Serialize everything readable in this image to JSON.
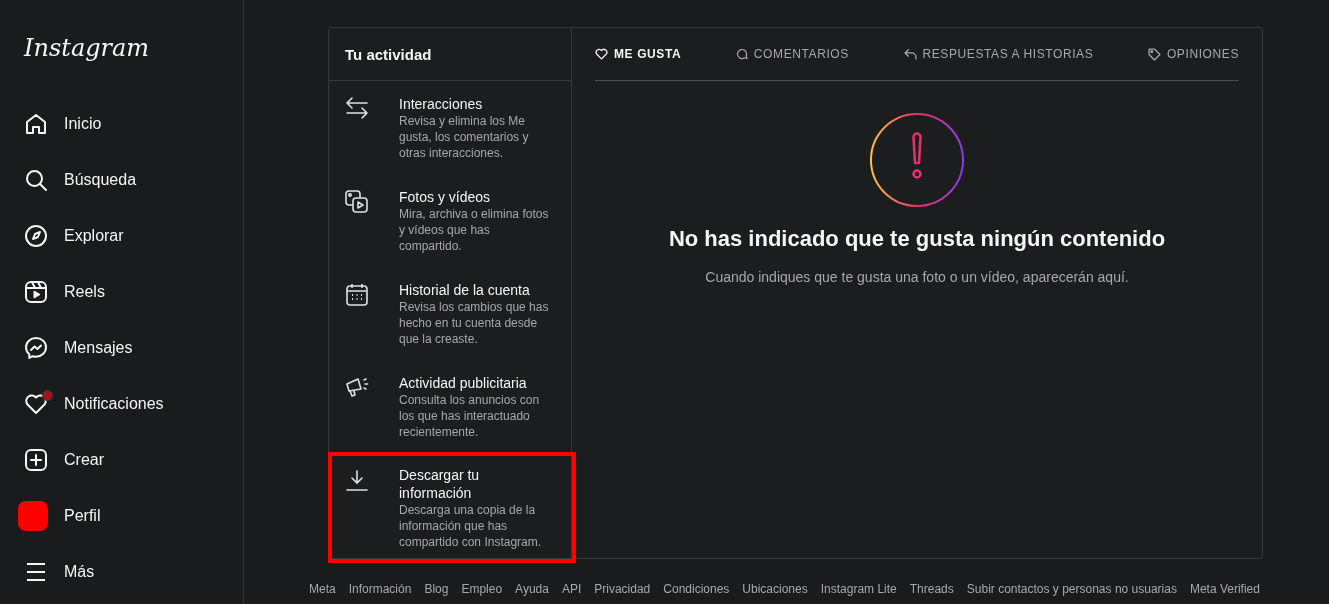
{
  "sidebar": {
    "logo": "Instagram",
    "items": [
      {
        "label": "Inicio",
        "kind": "home",
        "badge": false
      },
      {
        "label": "Búsqueda",
        "kind": "search",
        "badge": false
      },
      {
        "label": "Explorar",
        "kind": "compass",
        "badge": false
      },
      {
        "label": "Reels",
        "kind": "reels",
        "badge": false
      },
      {
        "label": "Mensajes",
        "kind": "messenger",
        "badge": false
      },
      {
        "label": "Notificaciones",
        "kind": "heart",
        "badge": true
      },
      {
        "label": "Crear",
        "kind": "plus",
        "badge": false
      },
      {
        "label": "Perfil",
        "kind": "avatar",
        "badge": false
      },
      {
        "label": "Más",
        "kind": "menu",
        "badge": false
      }
    ]
  },
  "activity": {
    "title": "Tu actividad",
    "items": [
      {
        "kind": "arrows",
        "title": "Interacciones",
        "description": "Revisa y elimina los Me gusta, los comentarios y otras interacciones.",
        "highlighted": false
      },
      {
        "kind": "media",
        "title": "Fotos y vídeos",
        "description": "Mira, archiva o elimina fotos y vídeos que has compartido.",
        "highlighted": false
      },
      {
        "kind": "calendar",
        "title": "Historial de la cuenta",
        "description": "Revisa los cambios que has hecho en tu cuenta desde que la creaste.",
        "highlighted": false
      },
      {
        "kind": "megaphone",
        "title": "Actividad publicitaria",
        "description": "Consulta los anuncios con los que has interactuado recientemente.",
        "highlighted": false
      },
      {
        "kind": "download",
        "title": "Descargar tu información",
        "description": "Descarga una copia de la información que has compartido con Instagram.",
        "highlighted": true
      }
    ]
  },
  "tabs": [
    {
      "label": "ME GUSTA",
      "kind": "heart",
      "selected": true
    },
    {
      "label": "COMENTARIOS",
      "kind": "bubble",
      "selected": false
    },
    {
      "label": "RESPUESTAS A HISTORIAS",
      "kind": "reply",
      "selected": false
    },
    {
      "label": "OPINIONES",
      "kind": "tag",
      "selected": false
    }
  ],
  "empty_state": {
    "title": "No has indicado que te gusta ningún contenido",
    "message": "Cuando indiques que te gusta una foto o un vídeo, aparecerán aquí."
  },
  "footer_links": [
    "Meta",
    "Información",
    "Blog",
    "Empleo",
    "Ayuda",
    "API",
    "Privacidad",
    "Condiciones",
    "Ubicaciones",
    "Instagram Lite",
    "Threads",
    "Subir contactos y personas no usuarias",
    "Meta Verified"
  ]
}
